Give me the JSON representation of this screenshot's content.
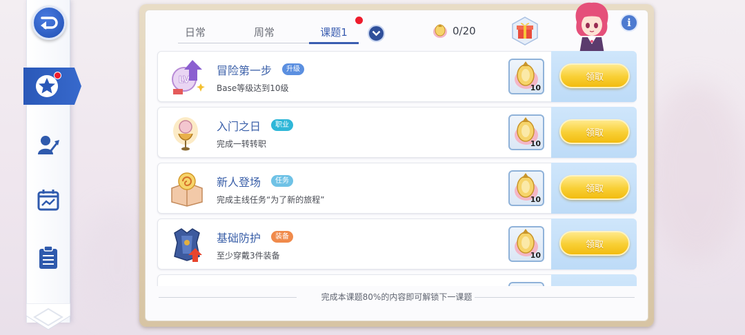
{
  "tabs": [
    {
      "label": "日常"
    },
    {
      "label": "周常"
    },
    {
      "label": "课题1"
    }
  ],
  "active_tab": "课题1",
  "counter": {
    "value": "0/20",
    "icon": "badge-icon"
  },
  "quests": [
    {
      "title": "冒险第一步",
      "tag": "升级",
      "tag_color": "#5b8fe0",
      "description": "Base等级达到10级",
      "icon": "level-up-icon",
      "reward_count": "10",
      "claim_label": "领取"
    },
    {
      "title": "入门之日",
      "tag": "职业",
      "tag_color": "#2fb7d8",
      "description": "完成一转转职",
      "icon": "job-change-icon",
      "reward_count": "10",
      "claim_label": "领取"
    },
    {
      "title": "新人登场",
      "tag": "任务",
      "tag_color": "#6fc2e6",
      "description": "完成主线任务“为了新的旅程”",
      "icon": "quest-book-icon",
      "reward_count": "10",
      "claim_label": "领取"
    },
    {
      "title": "基础防护",
      "tag": "装备",
      "tag_color": "#f08a4b",
      "description": "至少穿戴3件装备",
      "icon": "armor-icon",
      "reward_count": "10",
      "claim_label": "领取"
    }
  ],
  "footer_note": "完成本课题80%的内容即可解锁下一课题",
  "sidebar": {
    "items": [
      {
        "name": "back",
        "icon": "back-arrow-icon"
      },
      {
        "name": "achievement",
        "icon": "star-icon",
        "active": true,
        "has_alert": true
      },
      {
        "name": "character",
        "icon": "character-growth-icon"
      },
      {
        "name": "calendar",
        "icon": "calendar-chart-icon"
      },
      {
        "name": "notes",
        "icon": "clipboard-list-icon"
      }
    ]
  },
  "info_label": "i"
}
